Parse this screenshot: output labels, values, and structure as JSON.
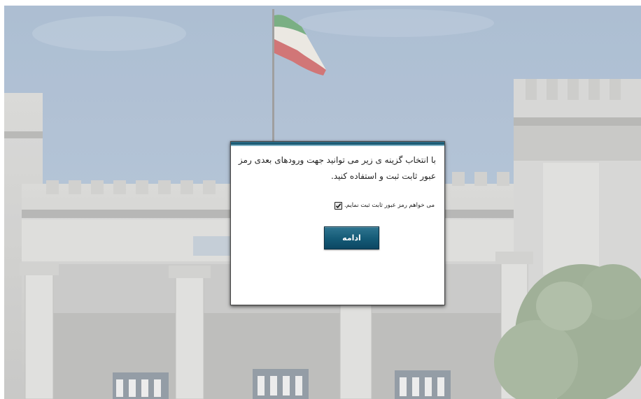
{
  "background": {
    "description_icon": "ministry-building-photo",
    "sky_color": "#9eb3cc",
    "stone_color": "#c9c9c9"
  },
  "dialog": {
    "message": "با انتخاب گزینه ی زیر می توانید جهت ورودهای بعدی رمز عبور ثابت ثبت و استفاده کنید.",
    "checkbox_label": "می خواهم رمز عبور ثابت ثبت نمایم.",
    "checkbox_checked": true,
    "continue_label": "ادامه",
    "accent_color": "#145a76"
  }
}
